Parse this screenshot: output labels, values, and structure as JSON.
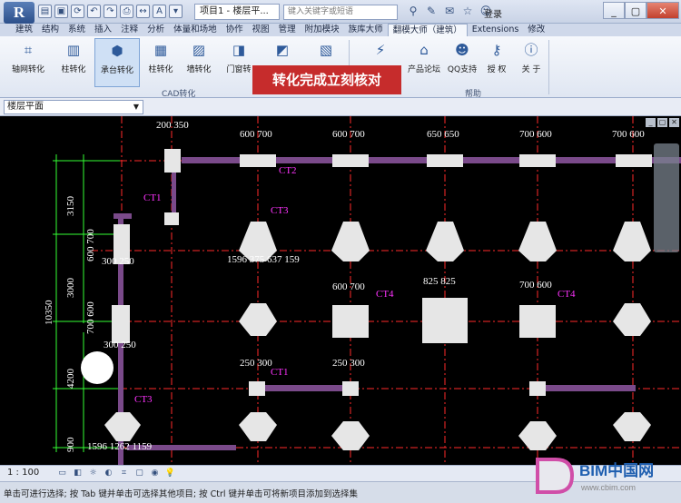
{
  "app": {
    "logo_letter": "R",
    "doc_tab": "项目1 - 楼层平...",
    "search_placeholder": "键入关键字或短语",
    "login_label": "登录",
    "window_controls": {
      "minimize": "_",
      "maximize": "▢",
      "close": "✕"
    }
  },
  "ribbon": {
    "tabs": [
      "建筑",
      "结构",
      "系统",
      "插入",
      "注释",
      "分析",
      "体量和场地",
      "协作",
      "视图",
      "管理",
      "附加模块",
      "族库大师",
      "翻模大师（建筑）",
      "Extensions",
      "修改"
    ],
    "active_tab_index": 12,
    "cad_buttons": [
      {
        "label": "轴网转化",
        "icon": "axis-grid-icon"
      },
      {
        "label": "柱转化",
        "icon": "column-icon"
      },
      {
        "label": "承台转化",
        "icon": "pile-cap-icon",
        "pressed": true
      },
      {
        "label": "柱转化",
        "icon": "column-icon"
      },
      {
        "label": "墙转化",
        "icon": "wall-icon"
      },
      {
        "label": "门窗转",
        "icon": "door-window-icon"
      }
    ],
    "cad_panel_label": "CAD转化",
    "help_buttons": [
      {
        "label": "产品论坛",
        "icon": "forum-icon"
      },
      {
        "label": "QQ支持",
        "icon": "qq-icon"
      },
      {
        "label": "授 权",
        "icon": "key-icon"
      },
      {
        "label": "关 于",
        "icon": "info-icon"
      }
    ],
    "help_panel_label": "帮助",
    "banner_text": "转化完成立刻核对"
  },
  "view_selector": {
    "value": "楼层平面"
  },
  "drawing": {
    "top_dims": [
      "200 350",
      "600 700",
      "600 700",
      "650 650",
      "700 600",
      "700 600"
    ],
    "mid_dims": [
      "600 700",
      "825 825",
      "700 600"
    ],
    "lower_dims": [
      "250 300",
      "250 300"
    ],
    "left_dims": [
      "3150",
      "3000",
      "10350",
      "4200",
      "900",
      "600 700",
      "700 600"
    ],
    "column_dims": [
      "300 250",
      "300 250"
    ],
    "labels": [
      "CT2",
      "CT1",
      "CT3",
      "CT4",
      "CT1",
      "CT3",
      "CT4"
    ],
    "bottom_dim": "1596 1262 1159",
    "cap_dim": "1596 375 637 159"
  },
  "view_control_bar": {
    "scale": "1 : 100"
  },
  "status_bar": {
    "text": "单击可进行选择; 按 Tab 键并单击可选择其他项目; 按 Ctrl 键并单击可将新项目添加到选择集"
  },
  "watermark": {
    "brand": "BIM中国网",
    "url": "www.cbim.com"
  },
  "colors": {
    "canvas": "#000000",
    "gridline": "#ff2a2a",
    "dimension": "#33ff33",
    "label": "#ff33ff",
    "banner": "#c62c2c"
  }
}
